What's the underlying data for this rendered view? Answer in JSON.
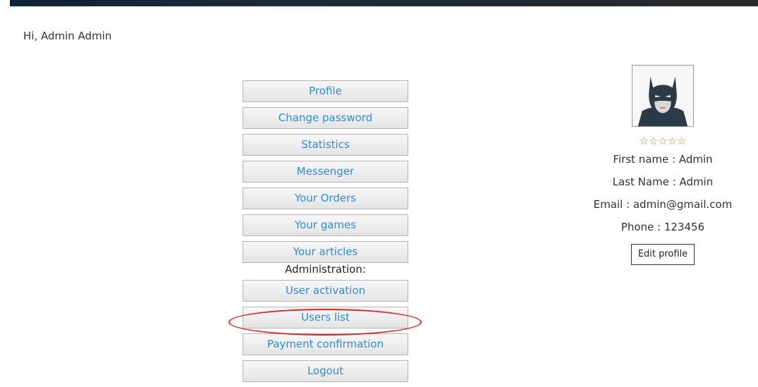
{
  "greeting": "Hi, Admin Admin",
  "menu": {
    "items": [
      {
        "label": "Profile"
      },
      {
        "label": "Change password"
      },
      {
        "label": "Statistics"
      },
      {
        "label": "Messenger"
      },
      {
        "label": "Your Orders"
      },
      {
        "label": "Your games"
      },
      {
        "label": "Your articles"
      }
    ],
    "admin_heading": "Administration:",
    "admin_items": [
      {
        "label": "User activation"
      },
      {
        "label": "Users list"
      },
      {
        "label": "Payment confirmation"
      },
      {
        "label": "Logout"
      }
    ]
  },
  "profile": {
    "avatar_icon": "batman-avatar-icon",
    "rating_stars": "☆☆☆☆☆",
    "rating_value": 0,
    "rating_max": 5,
    "first_name": "First name : Admin",
    "last_name": "Last Name : Admin",
    "email": "Email : admin@gmail.com",
    "phone": "Phone : 123456",
    "edit_button": "Edit profile"
  },
  "colors": {
    "link": "#2b8de4",
    "highlight": "#e0251f",
    "stars": "#c98a2c"
  }
}
